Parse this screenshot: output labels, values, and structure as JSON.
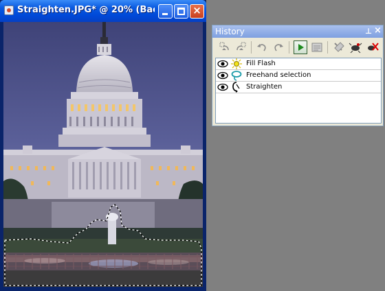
{
  "document_window": {
    "title": "Straighten.JPG* @  20% (Bac...",
    "buttons": {
      "minimize": "minimize",
      "maximize": "maximize",
      "close": "close"
    }
  },
  "history_palette": {
    "title": "History",
    "pin_glyph": "⊥",
    "close_glyph": "×",
    "toolbar": [
      "undo-to-selected-icon",
      "redo-to-selected-icon",
      "undo-icon",
      "redo-icon",
      "command-history-play-icon",
      "quickscript-icon",
      "clear-history-icon",
      "delete-steps-icon",
      "remove-icon"
    ],
    "items": [
      {
        "label": "Fill Flash",
        "icon": "fill-flash-icon",
        "visible": true
      },
      {
        "label": "Freehand selection",
        "icon": "freehand-selection-icon",
        "visible": true
      },
      {
        "label": "Straighten",
        "icon": "straighten-icon",
        "visible": true
      }
    ]
  },
  "colors": {
    "desktop": "#808080",
    "title_bar": "#0a5ae0",
    "palette_title": "#a9c0ee",
    "palette_body": "#ece9d8"
  }
}
